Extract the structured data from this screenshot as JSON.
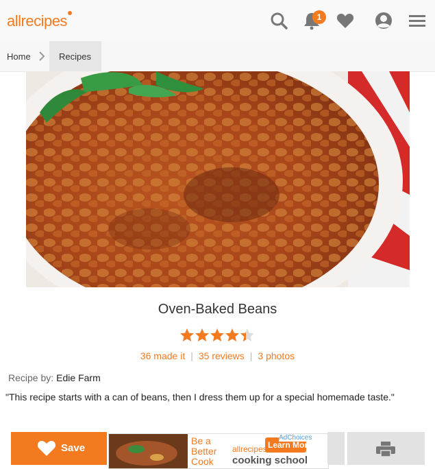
{
  "header": {
    "logo_text": "allrecipes",
    "notification_count": "1",
    "icons": [
      "search-icon",
      "bell-icon",
      "heart-icon",
      "user-icon",
      "menu-icon"
    ],
    "accent_color": "#f47a20"
  },
  "breadcrumb": {
    "home": "Home",
    "current": "Recipes"
  },
  "recipe": {
    "title": "Oven-Baked Beans",
    "rating": 4.5,
    "made_it": "36 made it",
    "reviews": "35 reviews",
    "photos": "3 photos",
    "byline_label": "Recipe by:",
    "author": "Edie Farm",
    "description": "\"This recipe starts with a can of beans, then I dress them up for a special homemade taste.\""
  },
  "footer": {
    "save_label": "Save",
    "ad": {
      "adchoices": "AdChoices",
      "tagline_1": "Be a",
      "tagline_2": "Better",
      "tagline_3": "Cook",
      "brand": "allrecipes",
      "cta": "Learn More",
      "school": "cooking school"
    }
  }
}
